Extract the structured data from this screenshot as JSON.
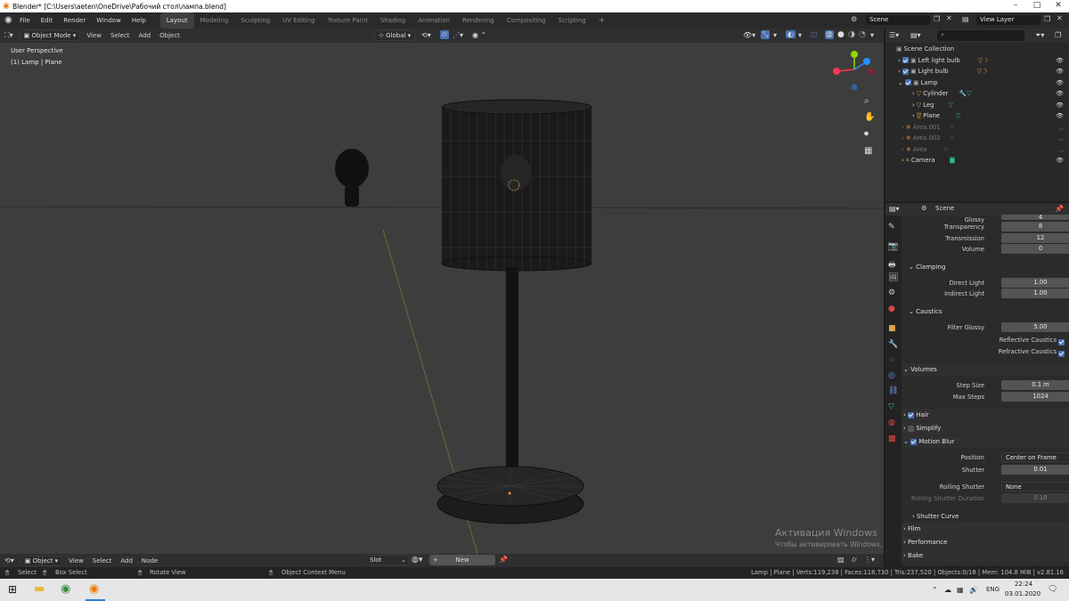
{
  "window": {
    "title": "Blender* [C:\\Users\\aeten\\OneDrive\\Рабочий стол\\лампа.blend]"
  },
  "menus": [
    "File",
    "Edit",
    "Render",
    "Window",
    "Help"
  ],
  "workspaces": [
    "Layout",
    "Modeling",
    "Sculpting",
    "UV Editing",
    "Texture Paint",
    "Shading",
    "Animation",
    "Rendering",
    "Compositing",
    "Scripting"
  ],
  "scene_field": "Scene",
  "view_layer_field": "View Layer",
  "viewport_header": {
    "mode": "Object Mode",
    "menus": [
      "View",
      "Select",
      "Add",
      "Object"
    ],
    "orientation": "Global"
  },
  "viewport": {
    "perspective": "User Perspective",
    "selection": "(1) Lamp | Plane"
  },
  "outliner": {
    "root": "Scene Collection",
    "items": [
      {
        "label": "Left light bulb",
        "indent": 1,
        "dim": false,
        "checkbox": true
      },
      {
        "label": "Light bulb",
        "indent": 1,
        "dim": false,
        "checkbox": true
      },
      {
        "label": "Lamp",
        "indent": 1,
        "dim": false,
        "checkbox": true
      },
      {
        "label": "Cylinder",
        "indent": 2,
        "dim": false,
        "checkbox": false
      },
      {
        "label": "Leg",
        "indent": 2,
        "dim": false,
        "checkbox": false
      },
      {
        "label": "Plane",
        "indent": 2,
        "dim": false,
        "checkbox": false
      },
      {
        "label": "Area.001",
        "indent": 1,
        "dim": true,
        "checkbox": false
      },
      {
        "label": "Area.002",
        "indent": 1,
        "dim": true,
        "checkbox": false
      },
      {
        "label": "Area",
        "indent": 1,
        "dim": true,
        "checkbox": false
      },
      {
        "label": "Camera",
        "indent": 1,
        "dim": false,
        "checkbox": false
      }
    ]
  },
  "properties": {
    "context": "Scene",
    "partial_top_label": "Glossy",
    "partial_top_value": "4",
    "rows_bounces": [
      {
        "label": "Transparency",
        "value": "8"
      },
      {
        "label": "Transmission",
        "value": "12"
      },
      {
        "label": "Volume",
        "value": "0"
      }
    ],
    "clamping": {
      "title": "Clamping",
      "rows": [
        {
          "label": "Direct Light",
          "value": "1.00"
        },
        {
          "label": "Indirect Light",
          "value": "1.00"
        }
      ]
    },
    "caustics": {
      "title": "Caustics",
      "filter_label": "Filter Glossy",
      "filter_value": "5.00",
      "reflective": "Reflective Caustics",
      "refractive": "Refractive Caustics"
    },
    "volumes": {
      "title": "Volumes",
      "rows": [
        {
          "label": "Step Size",
          "value": "0.1 m"
        },
        {
          "label": "Max Steps",
          "value": "1024"
        }
      ]
    },
    "hair": "Hair",
    "simplify": "Simplify",
    "motion_blur": {
      "title": "Motion Blur",
      "position_label": "Position",
      "position_value": "Center on Frame",
      "shutter_label": "Shutter",
      "shutter_value": "0.01",
      "rolling_label": "Rolling Shutter",
      "rolling_value": "None",
      "rolling_dur_label": "Rolling Shutter Duration",
      "rolling_dur_value": "0.10",
      "shutter_curve": "Shutter Curve"
    },
    "film": "Film",
    "performance": "Performance",
    "bake": "Bake"
  },
  "bottom_header": {
    "mode": "Object",
    "menus": [
      "View",
      "Select",
      "Add",
      "Node"
    ],
    "slot": "Slot",
    "new_button": "New"
  },
  "statusbar": {
    "select": "Select",
    "box_select": "Box Select",
    "rotate_view": "Rotate View",
    "context_menu": "Object Context Menu",
    "stats": "Lamp | Plane | Verts:119,238 | Faces:118,730 | Tris:237,520 | Objects:0/18 | Mem: 104.8 MiB | v2.81.16"
  },
  "watermark": {
    "title": "Активация Windows",
    "subtitle": "Чтобы активировать Windows, перейдите в раздел \"Параметры\"."
  },
  "taskbar": {
    "lang": "ENG",
    "time": "22:24",
    "date": "03.01.2020"
  },
  "colors": {
    "accent": "#4772b3",
    "active_tab": "#3f3f3f",
    "viewport_bg": "#3d3d3d",
    "axis_x": "#ff3352",
    "axis_y": "#8bdc00",
    "axis_z": "#2890ff"
  }
}
